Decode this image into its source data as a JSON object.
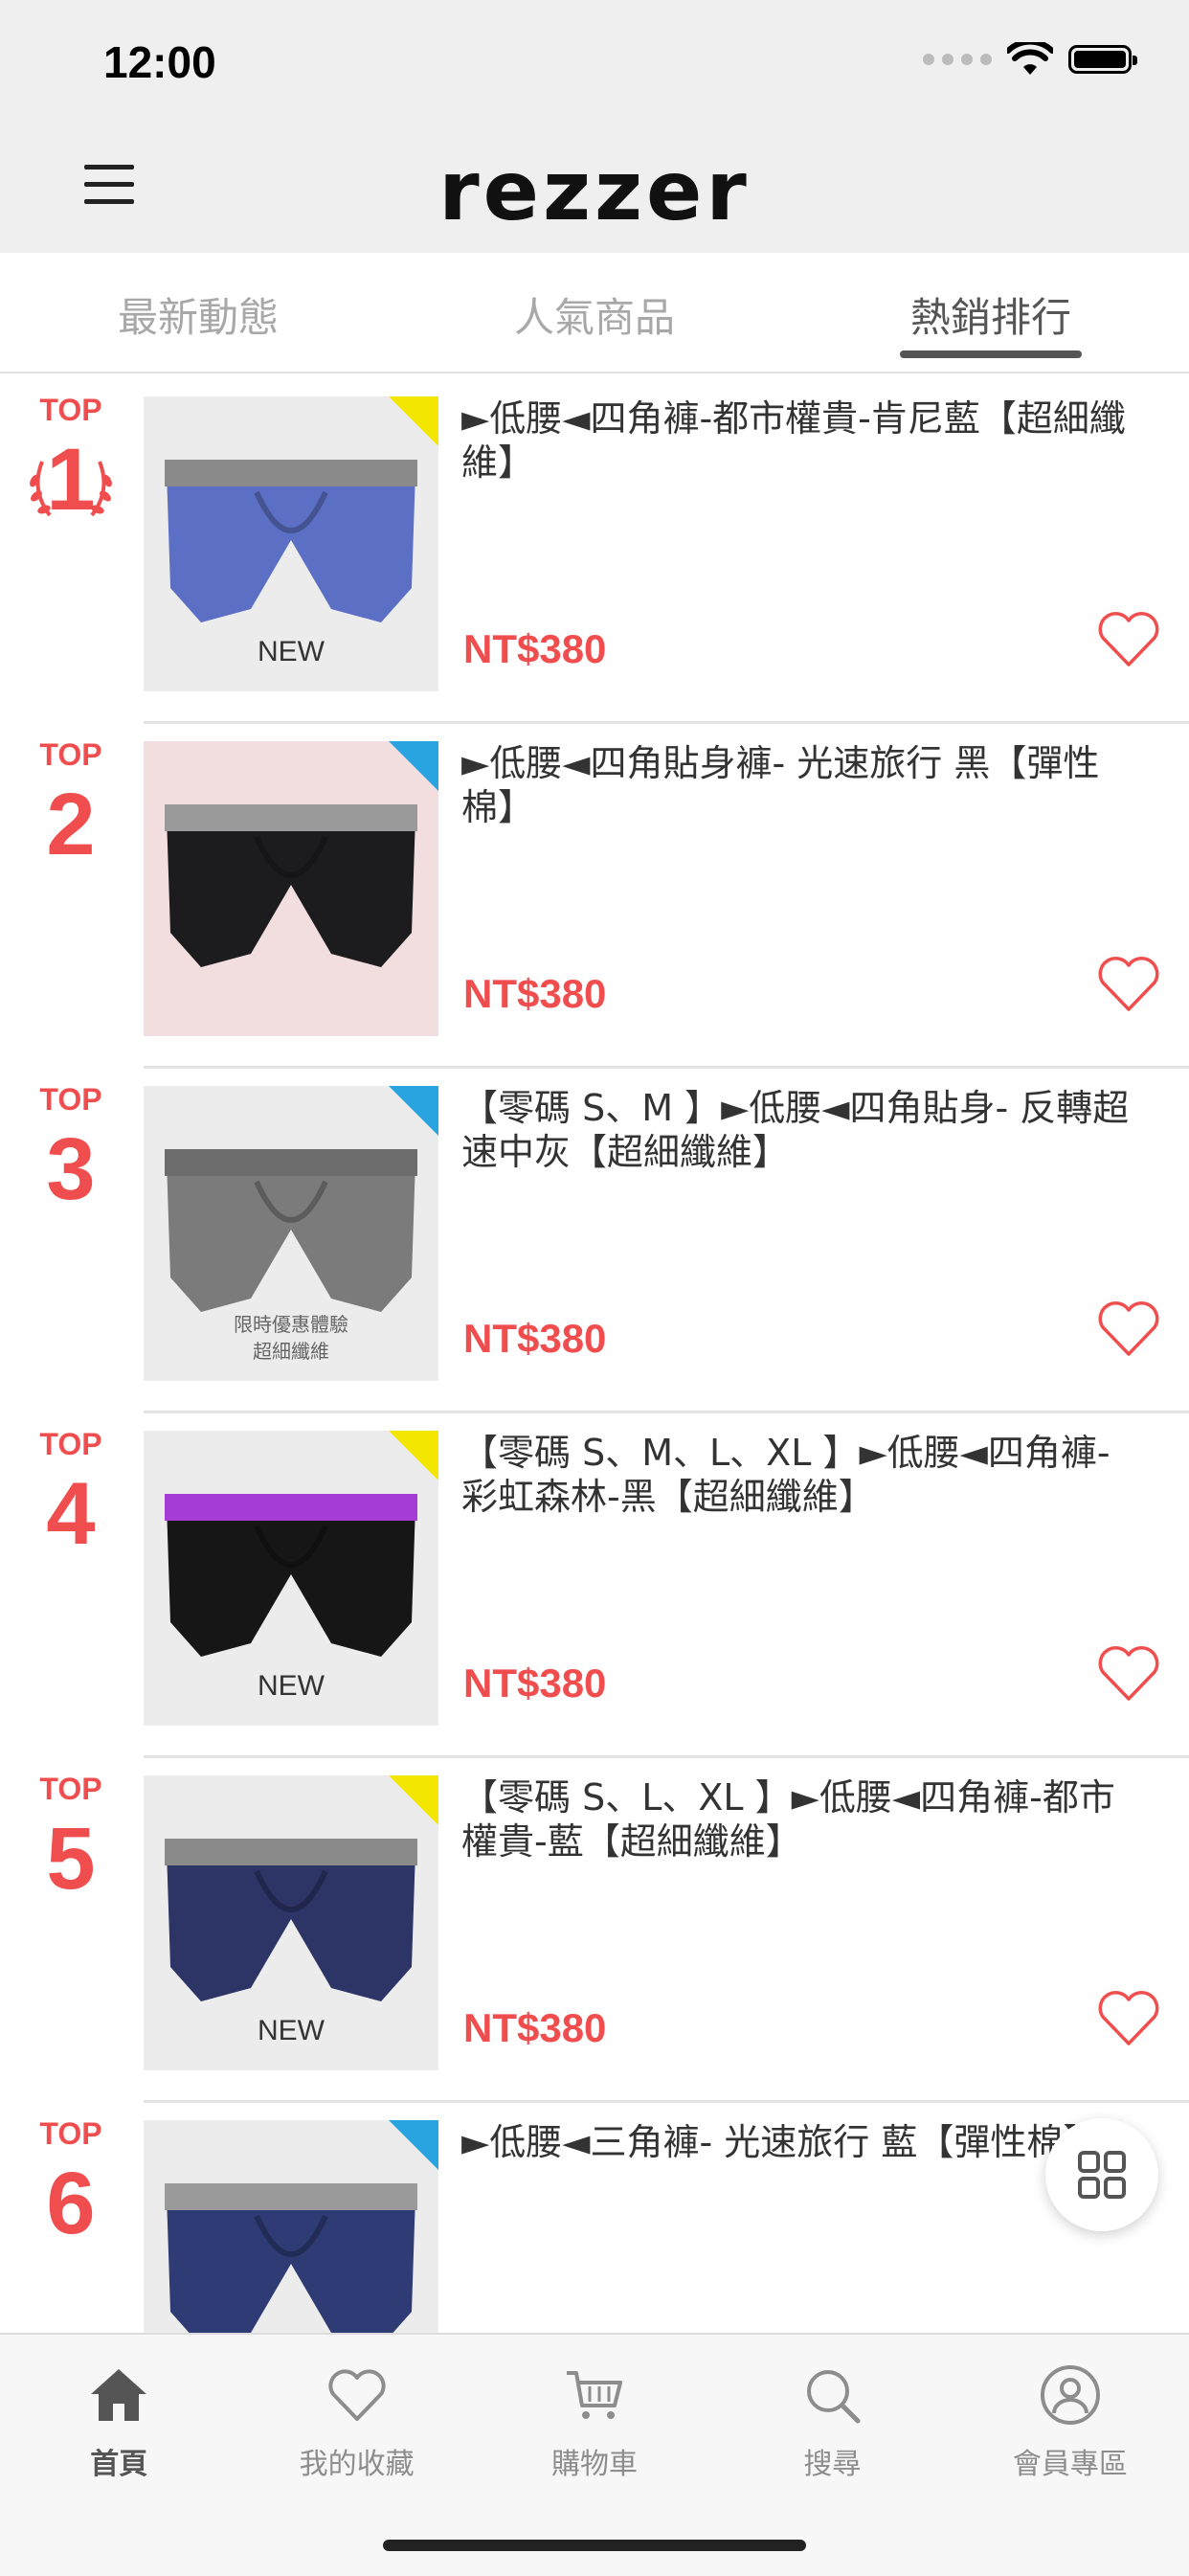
{
  "status_bar": {
    "time": "12:00"
  },
  "header": {
    "logo": "rezzer"
  },
  "tabs": [
    {
      "label": "最新動態",
      "active": false
    },
    {
      "label": "人氣商品",
      "active": false
    },
    {
      "label": "熱銷排行",
      "active": true
    }
  ],
  "products": [
    {
      "rank_prefix": "TOP",
      "rank": "1",
      "title": "►低腰◄四角褲-都市權貴-肯尼藍【超細纖維】",
      "price": "NT$380",
      "badge": "NEW",
      "corner": "yellow",
      "color": "#5b70c4",
      "waist": "#8a8a8a"
    },
    {
      "rank_prefix": "TOP",
      "rank": "2",
      "title": "►低腰◄四角貼身褲- 光速旅行 黑【彈性棉】",
      "price": "NT$380",
      "badge": "",
      "corner": "blue",
      "color": "#1c1c1f",
      "waist": "#9a9a9a"
    },
    {
      "rank_prefix": "TOP",
      "rank": "3",
      "title": "【零碼 S、M 】►低腰◄四角貼身- 反轉超速中灰【超細纖維】",
      "price": "NT$380",
      "badge": "",
      "badge_lines": [
        "限時優惠體驗",
        "超細纖維"
      ],
      "corner": "blue",
      "color": "#7b7b7b",
      "waist": "#6d6d6d"
    },
    {
      "rank_prefix": "TOP",
      "rank": "4",
      "title": "【零碼 S、M、L、XL 】►低腰◄四角褲-彩虹森林-黑【超細纖維】",
      "price": "NT$380",
      "badge": "NEW",
      "corner": "yellow",
      "color": "#161616",
      "waist": "#a53cd6"
    },
    {
      "rank_prefix": "TOP",
      "rank": "5",
      "title": "【零碼 S、L、XL 】►低腰◄四角褲-都市權貴-藍【超細纖維】",
      "price": "NT$380",
      "badge": "NEW",
      "corner": "yellow",
      "color": "#2d3466",
      "waist": "#8a8a8a"
    },
    {
      "rank_prefix": "TOP",
      "rank": "6",
      "title": "►低腰◄三角褲- 光速旅行 藍【彈性棉】",
      "price": "",
      "badge": "",
      "corner": "blue",
      "color": "#2f3b74",
      "waist": "#9a9a9a"
    }
  ],
  "bottom_nav": [
    {
      "label": "首頁",
      "icon": "home-icon",
      "active": true
    },
    {
      "label": "我的收藏",
      "icon": "heart-icon",
      "active": false
    },
    {
      "label": "購物車",
      "icon": "cart-icon",
      "active": false
    },
    {
      "label": "搜尋",
      "icon": "search-icon",
      "active": false
    },
    {
      "label": "會員專區",
      "icon": "user-icon",
      "active": false
    }
  ],
  "colors": {
    "accent": "#f04e4e",
    "text": "#333333",
    "muted": "#a8a8a8"
  }
}
